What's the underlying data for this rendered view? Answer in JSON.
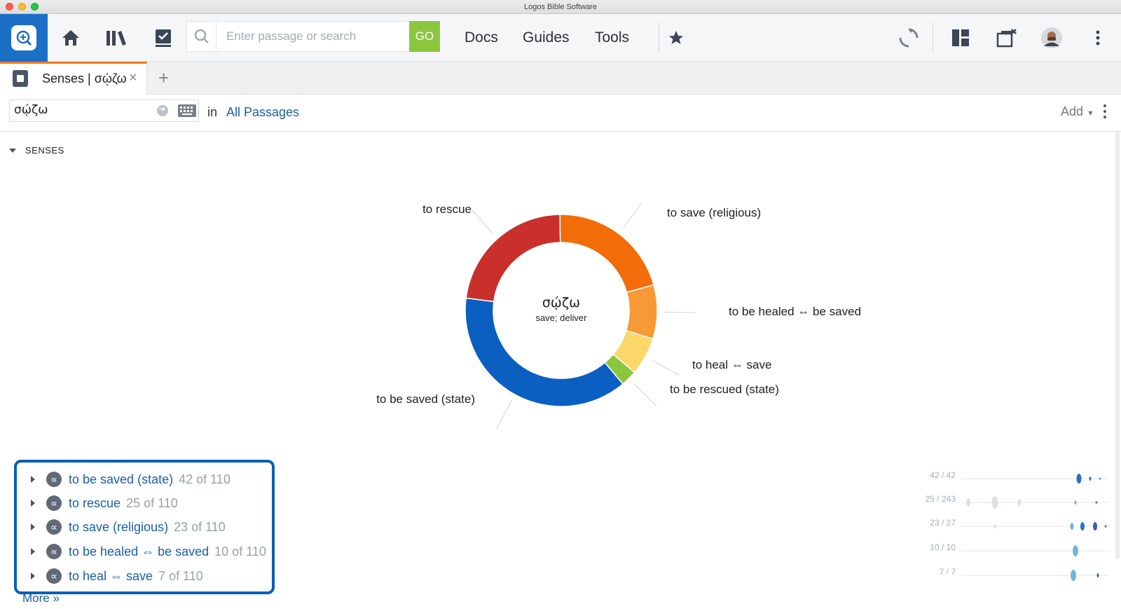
{
  "window": {
    "title": "Logos Bible Software"
  },
  "toolbar": {
    "search_placeholder": "Enter passage or search",
    "go_label": "GO",
    "nav": [
      "Docs",
      "Guides",
      "Tools"
    ]
  },
  "tab": {
    "title": "Senses | σῴζω"
  },
  "query": {
    "lemma": "σῴζω",
    "in_label": "in",
    "scope": "All Passages",
    "add_label": "Add"
  },
  "section": {
    "title": "SENSES"
  },
  "chart_data": {
    "type": "pie",
    "center_title": "σῴζω",
    "center_subtitle": "save; deliver",
    "categories": [
      "to be saved (state)",
      "to rescue",
      "to save (religious)",
      "to be healed ⇔ be saved",
      "to heal ⇔ save",
      "to be rescued (state)"
    ],
    "values": [
      42,
      25,
      23,
      10,
      7,
      3
    ],
    "colors": [
      "#0b5fc0",
      "#c9302c",
      "#f36c0a",
      "#f79a35",
      "#fcd86a",
      "#8cc63f"
    ]
  },
  "senses": [
    {
      "label": "to be saved (state)",
      "count": "42 of 110",
      "ratio": "42 / 42"
    },
    {
      "label": "to rescue",
      "count": "25 of 110",
      "ratio": "25 / 243"
    },
    {
      "label": "to save (religious)",
      "count": "23 of 110",
      "ratio": "23 / 27"
    },
    {
      "label": "to be healed ⇔ be saved",
      "count": "10 of 110",
      "ratio": "10 / 10"
    },
    {
      "label": "to heal ⇔ save",
      "count": "7 of 110",
      "ratio": "7 / 7"
    }
  ],
  "more_label": "More »",
  "colors": {
    "accent_blue": "#1b5fa8",
    "go_green": "#8cc63f",
    "tab_orange": "#f07c1e"
  }
}
